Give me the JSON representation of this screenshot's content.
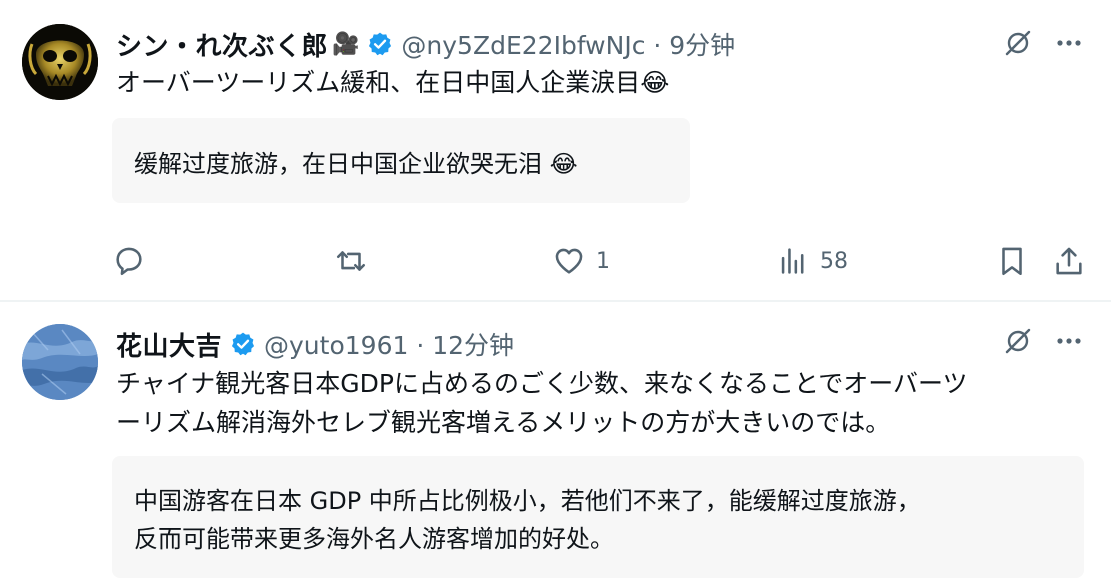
{
  "colors": {
    "verified": "#1d9bf0",
    "muted": "#536471",
    "text": "#0f1419",
    "translation_bg": "#f7f7f7"
  },
  "tweets": [
    {
      "display_name": "シン・れ次ぶく郎",
      "name_emoji": "🎥",
      "handle_time": "@ny5ZdE22IbfwNJc · 9分钟",
      "text": "オーバーツーリズム緩和、在日中国人企業涙目😂",
      "translation": "缓解过度旅游，在日中国企业欲哭无泪 😂",
      "counts": {
        "reply": "",
        "retweet": "",
        "like": "1",
        "views": "58"
      },
      "icons": [
        "reply-icon",
        "retweet-icon",
        "like-icon",
        "views-icon",
        "bookmark-icon",
        "share-icon"
      ]
    },
    {
      "display_name": "花山大吉",
      "handle_time": "@yuto1961 · 12分钟",
      "text_line1": "チャイナ観光客日本GDPに占めるのごく少数、来なくなることでオーバーツ",
      "text_line2": "ーリズム解消海外セレブ観光客増えるメリットの方が大きいのでは。",
      "translation_line1": "中国游客在日本 GDP 中所占比例极小，若他们不来了，能缓解过度旅游，",
      "translation_line2": "反而可能带来更多海外名人游客增加的好处。"
    }
  ]
}
